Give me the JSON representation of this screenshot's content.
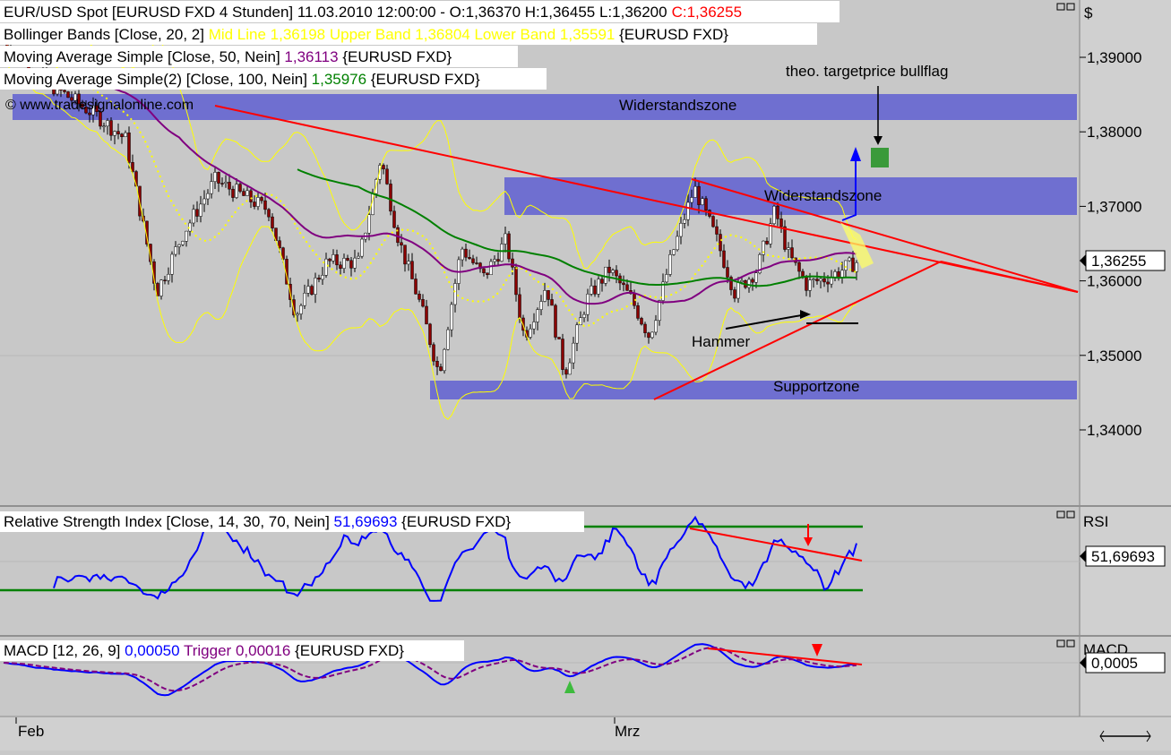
{
  "header": {
    "title": "EUR/USD Spot [EURUSD FXD  4 Stunden] 11.03.2010 12:00:00 - O:1,36370 H:1,36455 L:1,36200",
    "close_label": "C:1,36255"
  },
  "indicators": {
    "bollinger": {
      "prefix": "Bollinger Bands [Close, 20, 2] ",
      "values": "Mid Line 1,36198 Upper Band 1,36804 Lower Band 1,35591",
      "suffix": " {EURUSD FXD}"
    },
    "ma50": {
      "prefix": "Moving Average Simple [Close, 50, Nein] ",
      "value": "1,36113",
      "suffix": " {EURUSD FXD}"
    },
    "ma100": {
      "prefix": "Moving Average Simple(2) [Close, 100, Nein] ",
      "value": "1,35976",
      "suffix": " {EURUSD FXD}"
    },
    "copyright": "© www.tradesignalonline.com"
  },
  "annotations": {
    "resistance_top": "Widerstandszone",
    "resistance_mid": "Widerstandszone",
    "support": "Supportzone",
    "target": "theo. targetprice bullflag",
    "hammer": "Hammer"
  },
  "rsi": {
    "prefix": "Relative Strength Index [Close, 14, 30, 70, Nein] ",
    "value": "51,69693",
    "suffix": " {EURUSD FXD}",
    "axis_label": "RSI",
    "value_box": "51,69693"
  },
  "macd": {
    "prefix": "MACD [12, 26, 9] ",
    "value": "0,00050",
    "trigger_label": " Trigger ",
    "trigger_value": "0,00016",
    "suffix": " {EURUSD FXD}",
    "axis_label": "MACD",
    "value_box": "0,0005"
  },
  "price_axis": {
    "currency": "$",
    "ticks": [
      "1,39000",
      "1,38000",
      "1,37000",
      "1,36000",
      "1,35000",
      "1,34000"
    ],
    "last_price": "1,36255"
  },
  "time_axis": {
    "labels": [
      "Feb",
      "Mrz"
    ]
  },
  "colors": {
    "background": "#c8c8c8",
    "candle_up": "#ffffff",
    "candle_down": "#8b0000",
    "bollinger": "#ffff00",
    "ma50": "#800080",
    "ma100": "#008000",
    "zone": "#6f6fd0",
    "trendline": "#ff0000",
    "rsi_line": "#0000ff",
    "rsi_levels": "#008000",
    "macd_line": "#0000ff",
    "macd_trigger": "#800080",
    "close_text": "#ff0000"
  },
  "chart_data": [
    {
      "type": "line",
      "x_labels": [
        "Feb",
        "Mrz"
      ],
      "ylim": [
        1.34,
        1.39
      ],
      "series": [
        {
          "name": "Mid Line",
          "last": 1.36198
        },
        {
          "name": "Upper Band",
          "last": 1.36804
        },
        {
          "name": "Lower Band",
          "last": 1.35591
        },
        {
          "name": "Moving Average Simple",
          "last": 1.36113
        },
        {
          "name": "Moving Average Simple(2)",
          "last": 1.35976
        }
      ],
      "close": 1.36255,
      "open": 1.3637,
      "high": 1.36455,
      "low": 1.362
    },
    {
      "type": "line",
      "series": [
        {
          "name": "Relative Strength Index",
          "last": 51.69693
        }
      ],
      "levels": [
        30,
        70
      ]
    },
    {
      "type": "line",
      "series": [
        {
          "name": "MACD",
          "last": 0.0005
        },
        {
          "name": "Trigger",
          "last": 0.00016
        }
      ]
    }
  ]
}
